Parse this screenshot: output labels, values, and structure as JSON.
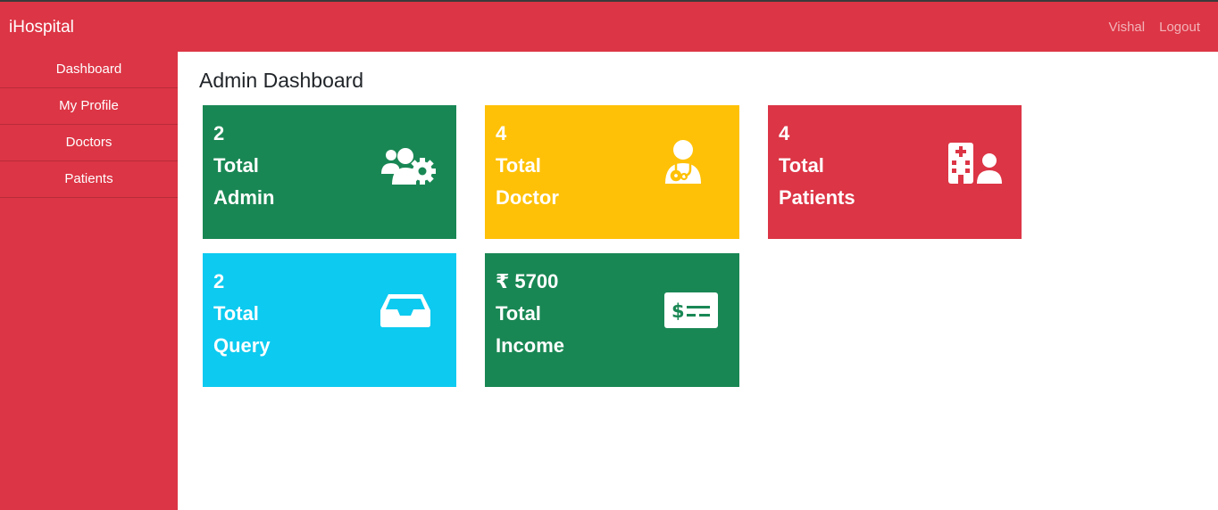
{
  "header": {
    "brand": "iHospital",
    "user": "Vishal",
    "logout": "Logout"
  },
  "sidebar": {
    "items": [
      {
        "label": "Dashboard"
      },
      {
        "label": "My Profile"
      },
      {
        "label": "Doctors"
      },
      {
        "label": "Patients"
      }
    ]
  },
  "main": {
    "title": "Admin Dashboard"
  },
  "cards": [
    {
      "value": "2",
      "line1": "Total",
      "line2": "Admin",
      "color": "#198754",
      "icon": "users-gear-icon"
    },
    {
      "value": "4",
      "line1": "Total",
      "line2": "Doctor",
      "color": "#ffc107",
      "icon": "user-doctor-icon"
    },
    {
      "value": "4",
      "line1": "Total",
      "line2": "Patients",
      "color": "#dc3545",
      "icon": "hospital-user-icon"
    },
    {
      "value": "2",
      "line1": "Total",
      "line2": "Query",
      "color": "#0dcaf0",
      "icon": "inbox-icon"
    },
    {
      "value": "₹ 5700",
      "line1": "Total",
      "line2": "Income",
      "color": "#198754",
      "icon": "money-check-dollar-icon"
    }
  ]
}
